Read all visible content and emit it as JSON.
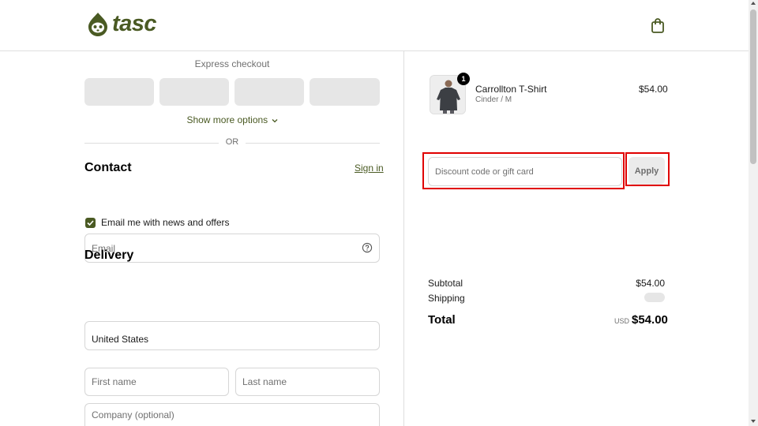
{
  "brand": {
    "name": "tasc",
    "color": "#4a5a23"
  },
  "header": {
    "cart_icon": "shopping-bag-icon"
  },
  "express": {
    "title": "Express checkout",
    "show_more": "Show more options",
    "or": "OR"
  },
  "contact": {
    "title": "Contact",
    "signin": "Sign in",
    "email_placeholder": "Email",
    "newsletter_label": "Email me with news and offers",
    "newsletter_checked": true
  },
  "delivery": {
    "title": "Delivery",
    "country": "United States",
    "first_name_placeholder": "First name",
    "last_name_placeholder": "Last name",
    "company_placeholder": "Company (optional)"
  },
  "cart": {
    "items": [
      {
        "name": "Carrollton T-Shirt",
        "variant": "Cinder / M",
        "price": "$54.00",
        "quantity": "1"
      }
    ]
  },
  "discount": {
    "placeholder": "Discount code or gift card",
    "apply_label": "Apply",
    "highlight_color": "#e00000"
  },
  "summary": {
    "subtotal_label": "Subtotal",
    "subtotal_value": "$54.00",
    "shipping_label": "Shipping",
    "total_label": "Total",
    "currency": "USD",
    "total_value": "$54.00"
  }
}
